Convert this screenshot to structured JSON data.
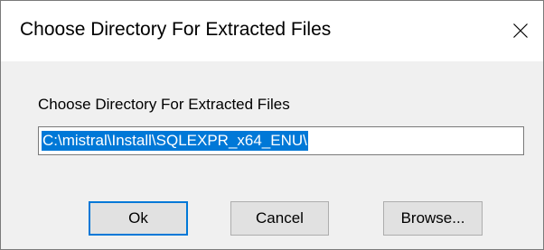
{
  "window": {
    "title": "Choose Directory For Extracted Files",
    "close_icon": "close-icon"
  },
  "form": {
    "label": "Choose Directory For Extracted Files",
    "path_value": "C:\\mistral\\Install\\SQLEXPR_x64_ENU\\"
  },
  "buttons": {
    "ok": "Ok",
    "cancel": "Cancel",
    "browse": "Browse..."
  },
  "colors": {
    "accent": "#0078d7",
    "dialog_bg": "#f0f0f0",
    "title_bg": "#ffffff",
    "button_bg": "#e1e1e1"
  }
}
